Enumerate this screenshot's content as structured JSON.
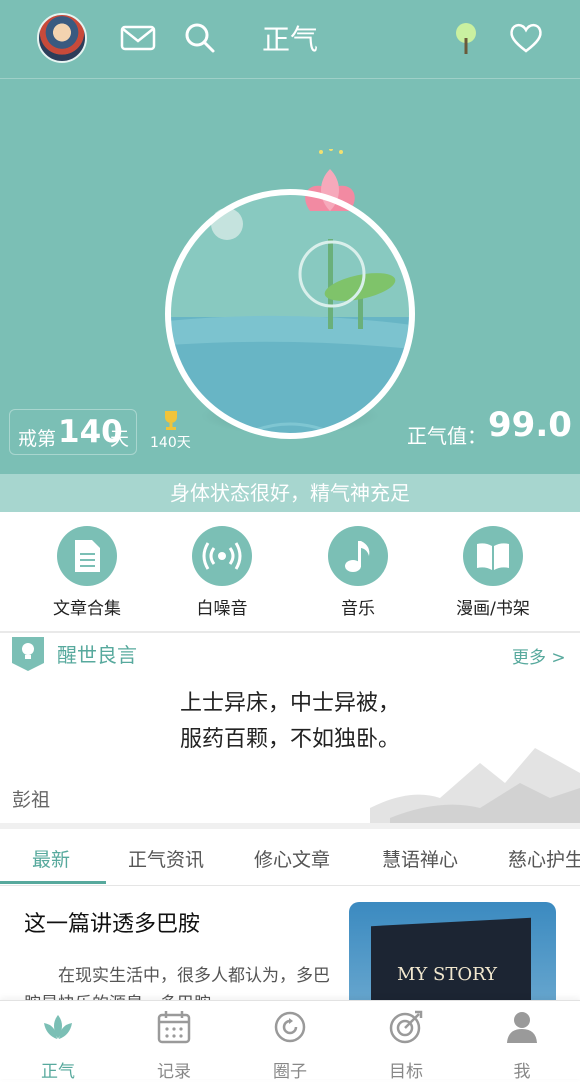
{
  "header": {
    "title": "正气",
    "avatar_icon": "user-avatar",
    "mail_icon": "mail-icon",
    "search_icon": "search-icon",
    "tree_icon": "tree-icon",
    "heart_icon": "heart-icon",
    "accent_color": "#7bbfb5"
  },
  "hero": {
    "abstain_prefix": "戒第",
    "abstain_days": "140",
    "abstain_unit": "天",
    "best_record": "140天",
    "zhengqi_label": "正气值：",
    "zhengqi_value": "99.0",
    "status_text": "身体状态很好，精气神充足"
  },
  "features": [
    {
      "label": "文章合集",
      "icon": "document-icon"
    },
    {
      "label": "白噪音",
      "icon": "radio-waves-icon"
    },
    {
      "label": "音乐",
      "icon": "music-note-icon"
    },
    {
      "label": "漫画/书架",
      "icon": "open-book-icon"
    }
  ],
  "quote": {
    "section_title": "醒世良言",
    "more": "更多 >",
    "line1": "上士异床，中士异被，",
    "line2": "服药百颗，不如独卧。",
    "author": "彭祖"
  },
  "tabs": [
    {
      "label": "最新",
      "active": true
    },
    {
      "label": "正气资讯",
      "active": false
    },
    {
      "label": "修心文章",
      "active": false
    },
    {
      "label": "慧语禅心",
      "active": false
    },
    {
      "label": "慈心护生",
      "active": false
    }
  ],
  "article": {
    "title": "这一篇讲透多巴胺",
    "excerpt": "在现实生活中，很多人都认为，多巴胺是快乐的源泉，多巴胺",
    "thumbnail_text": "MY STORY"
  },
  "bottom_nav": [
    {
      "label": "正气",
      "icon": "lotus-icon",
      "active": true
    },
    {
      "label": "记录",
      "icon": "calendar-icon",
      "active": false
    },
    {
      "label": "圈子",
      "icon": "circle-refresh-icon",
      "active": false
    },
    {
      "label": "目标",
      "icon": "target-icon",
      "active": false
    },
    {
      "label": "我",
      "icon": "person-icon",
      "active": false
    }
  ]
}
